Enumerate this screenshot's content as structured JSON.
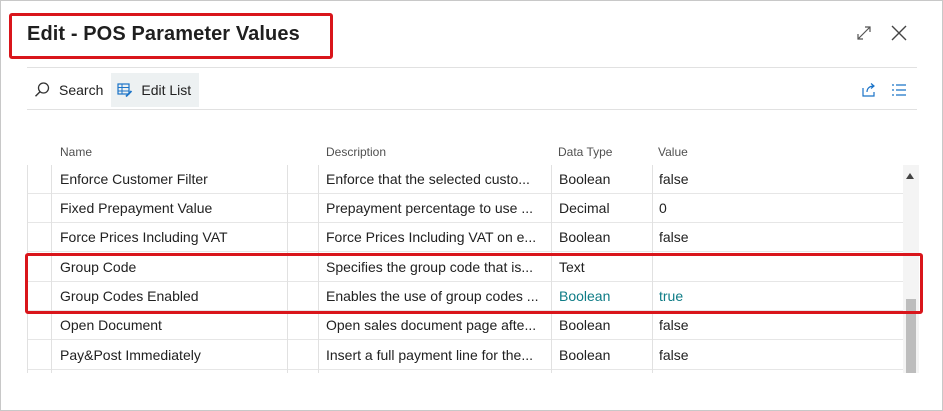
{
  "dialog": {
    "title": "Edit - POS Parameter Values"
  },
  "toolbar": {
    "search_label": "Search",
    "edit_list_label": "Edit List"
  },
  "table": {
    "columns": [
      "Name",
      "Description",
      "Data Type",
      "Value"
    ],
    "rows": [
      {
        "name": "Enforce Customer Filter",
        "description": "Enforce that the selected custo...",
        "data_type": "Boolean",
        "value": "false"
      },
      {
        "name": "Fixed Prepayment Value",
        "description": "Prepayment percentage to use ...",
        "data_type": "Decimal",
        "value": "0"
      },
      {
        "name": "Force Prices Including VAT",
        "description": "Force Prices Including VAT on e...",
        "data_type": "Boolean",
        "value": "false"
      },
      {
        "name": "Group Code",
        "description": "Specifies the group code that is...",
        "data_type": "Text",
        "value": ""
      },
      {
        "name": "Group Codes Enabled",
        "description": "Enables the use of group codes ...",
        "data_type": "Boolean",
        "value": "true"
      },
      {
        "name": "Open Document",
        "description": "Open sales document page afte...",
        "data_type": "Boolean",
        "value": "false"
      },
      {
        "name": "Pay&Post Immediately",
        "description": "Insert a full payment line for the...",
        "data_type": "Boolean",
        "value": "false"
      }
    ]
  },
  "colors": {
    "highlight": "#d9151b",
    "link_teal": "#0e7c86",
    "accent_blue": "#1a73c8"
  },
  "icons": {
    "expand": "expand-icon",
    "close": "close-icon",
    "search": "search-icon",
    "edit_list": "edit-list-icon",
    "share": "share-icon",
    "list_view": "list-view-icon"
  }
}
